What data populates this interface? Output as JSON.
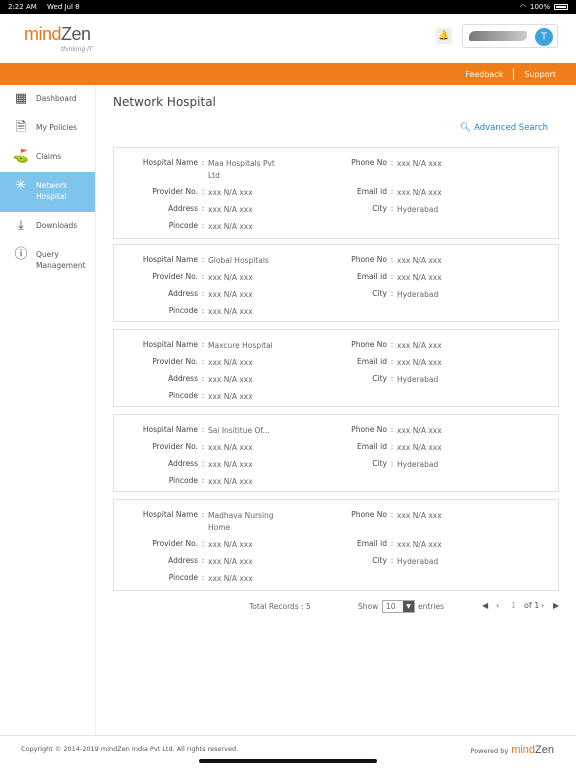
{
  "status": {
    "time": "2:22 AM",
    "date": "Wed Jul 8",
    "battery": "100%"
  },
  "header": {
    "logo_main": "mind",
    "logo_accent": "Zen",
    "logo_tag": "thinking IT",
    "avatar_initial": "T"
  },
  "topbar": {
    "feedback": "Feedback",
    "support": "Support"
  },
  "sidebar": {
    "items": [
      {
        "label": "Dashboard"
      },
      {
        "label": "My Policies"
      },
      {
        "label": "Claims"
      },
      {
        "label": "Network Hospital"
      },
      {
        "label": "Downloads"
      },
      {
        "label": "Query Management"
      }
    ]
  },
  "main": {
    "title": "Network Hospital",
    "advanced_search": "Advanced Search",
    "labels": {
      "hospital_name": "Hospital Name",
      "provider_no": "Provider No.",
      "address": "Address",
      "pincode": "Pincode",
      "phone_no": "Phone No",
      "email_id": "Email id",
      "city": "City"
    },
    "records": [
      {
        "name": "Maa Hospitals Pvt Ltd",
        "provider": "xxx N/A xxx",
        "address": "xxx N/A xxx",
        "pincode": "xxx N/A xxx",
        "phone": "xxx N/A xxx",
        "email": "xxx N/A xxx",
        "city": "Hyderabad"
      },
      {
        "name": "Global Hospitals",
        "provider": "xxx N/A xxx",
        "address": "xxx N/A xxx",
        "pincode": "xxx N/A xxx",
        "phone": "xxx N/A xxx",
        "email": "xxx N/A xxx",
        "city": "Hyderabad"
      },
      {
        "name": "Maxcure Hospital",
        "provider": "xxx N/A xxx",
        "address": "xxx N/A xxx",
        "pincode": "xxx N/A xxx",
        "phone": "xxx N/A xxx",
        "email": "xxx N/A xxx",
        "city": "Hyderabad"
      },
      {
        "name": "Sai Insititue Of...",
        "provider": "xxx N/A xxx",
        "address": "xxx N/A xxx",
        "pincode": "xxx N/A xxx",
        "phone": "xxx N/A xxx",
        "email": "xxx N/A xxx",
        "city": "Hyderabad"
      },
      {
        "name": "Madhava Nursing Home",
        "provider": "xxx N/A xxx",
        "address": "xxx N/A xxx",
        "pincode": "xxx N/A xxx",
        "phone": "xxx N/A xxx",
        "email": "xxx N/A xxx",
        "city": "Hyderabad"
      }
    ],
    "pager": {
      "total_records": "Total Records : 5",
      "show": "Show",
      "page_size": "10",
      "entries": "entries",
      "page": "1",
      "of_pages": "of 1"
    }
  },
  "footer": {
    "copyright": "Copyright © 2014-2019 mindZen India Pvt Ltd. All rights reserved.",
    "powered_by": "Powered by",
    "brand_main": "mind",
    "brand_accent": "Zen"
  }
}
